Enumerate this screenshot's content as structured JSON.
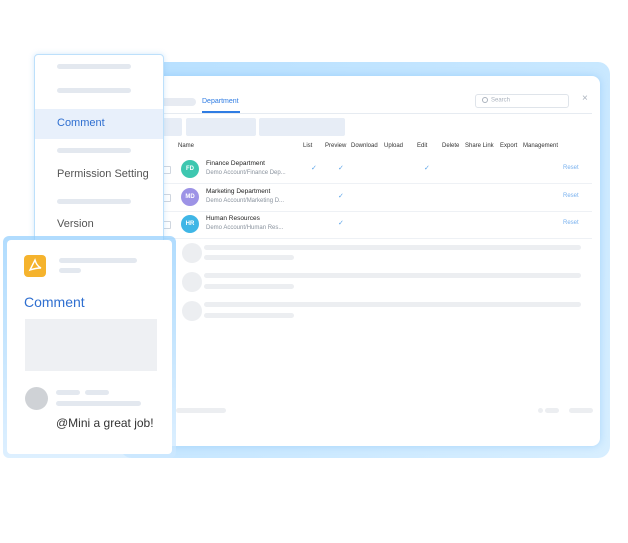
{
  "tabs": {
    "active": "Department"
  },
  "search": {
    "placeholder": "Search"
  },
  "close_glyph": "×",
  "columns": [
    "Name",
    "List",
    "Preview",
    "Download",
    "Upload",
    "Edit",
    "Delete",
    "Share Link",
    "Export",
    "Management"
  ],
  "rows": [
    {
      "initials": "FD",
      "avatar_color": "#3ec7b0",
      "name": "Finance Department",
      "path": "Demo Account/Finance Dep...",
      "list": true,
      "preview": true,
      "edit": true,
      "action": "Reset"
    },
    {
      "initials": "MD",
      "avatar_color": "#9d93e6",
      "name": "Marketing Department",
      "path": "Demo Account/Marketing D...",
      "list": false,
      "preview": true,
      "edit": false,
      "action": "Reset"
    },
    {
      "initials": "HR",
      "avatar_color": "#3fb6e6",
      "name": "Human Resources",
      "path": "Demo Account/Human Res...",
      "list": false,
      "preview": true,
      "edit": false,
      "action": "Reset"
    }
  ],
  "check_glyph": "✓",
  "menu": {
    "items": [
      {
        "label": "Comment",
        "active": true
      },
      {
        "label": "Permission Setting",
        "active": false
      },
      {
        "label": "Version",
        "active": false
      }
    ]
  },
  "comment_card": {
    "file_icon": "pdf-icon",
    "title": "Comment",
    "comment_text": "@Mini a great job!"
  },
  "colors": {
    "accent": "#2f6fd0",
    "link": "#7ab2ef",
    "pdf": "#f5b32d"
  }
}
